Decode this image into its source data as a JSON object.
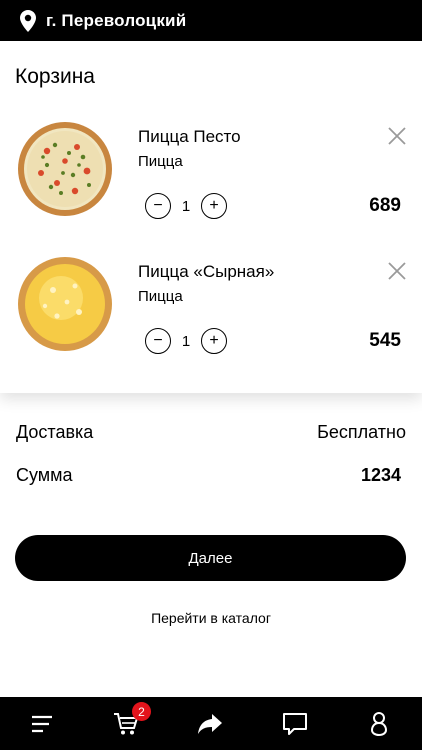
{
  "header": {
    "city": "г. Переволоцкий"
  },
  "cart": {
    "title": "Корзина",
    "items": [
      {
        "name": "Пицца Песто",
        "category": "Пицца",
        "quantity": "1",
        "price": "689"
      },
      {
        "name": "Пицца «Сырная»",
        "category": "Пицца",
        "quantity": "1",
        "price": "545"
      }
    ]
  },
  "summary": {
    "delivery_label": "Доставка",
    "delivery_value": "Бесплатно",
    "total_label": "Сумма",
    "total_value": "1234"
  },
  "actions": {
    "next_label": "Далее",
    "catalog_link": "Перейти в каталог"
  },
  "tabbar": {
    "cart_badge": "2",
    "icons": [
      "menu-icon",
      "cart-icon",
      "share-icon",
      "chat-icon",
      "profile-icon"
    ]
  },
  "colors": {
    "badge": "#e3141c",
    "bar": "#000000"
  }
}
